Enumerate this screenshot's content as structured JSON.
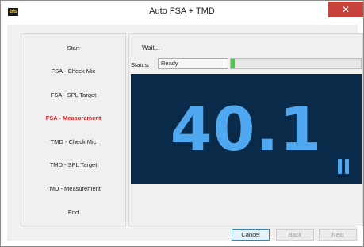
{
  "window": {
    "title": "Auto FSA + TMD",
    "app_icon_text": "bis",
    "close_symbol": "✕"
  },
  "steps": {
    "items": [
      {
        "label": "Start",
        "active": false
      },
      {
        "label": "FSA - Check Mic",
        "active": false
      },
      {
        "label": "FSA - SPL Target",
        "active": false
      },
      {
        "label": "FSA - Measurement",
        "active": true
      },
      {
        "label": "TMD - Check Mic",
        "active": false
      },
      {
        "label": "TMD - SPL Target",
        "active": false
      },
      {
        "label": "TMD - Measurement",
        "active": false
      },
      {
        "label": "End",
        "active": false
      }
    ]
  },
  "main": {
    "wait_text": "Wait...",
    "status_label": "Status:",
    "status_value": "Ready",
    "progress_percent": 3,
    "reading": "40.1"
  },
  "buttons": {
    "cancel": "Cancel",
    "back": "Back",
    "next": "Next"
  },
  "colors": {
    "active_step": "#d92424",
    "display_background": "#0a2a4a",
    "display_text": "#4fa8f0",
    "progress_fill": "#3fcf3f",
    "close_button": "#c7423a"
  },
  "icons": {
    "app": "bis-app-icon",
    "close": "close-icon",
    "measurement_state": "pause-icon"
  }
}
